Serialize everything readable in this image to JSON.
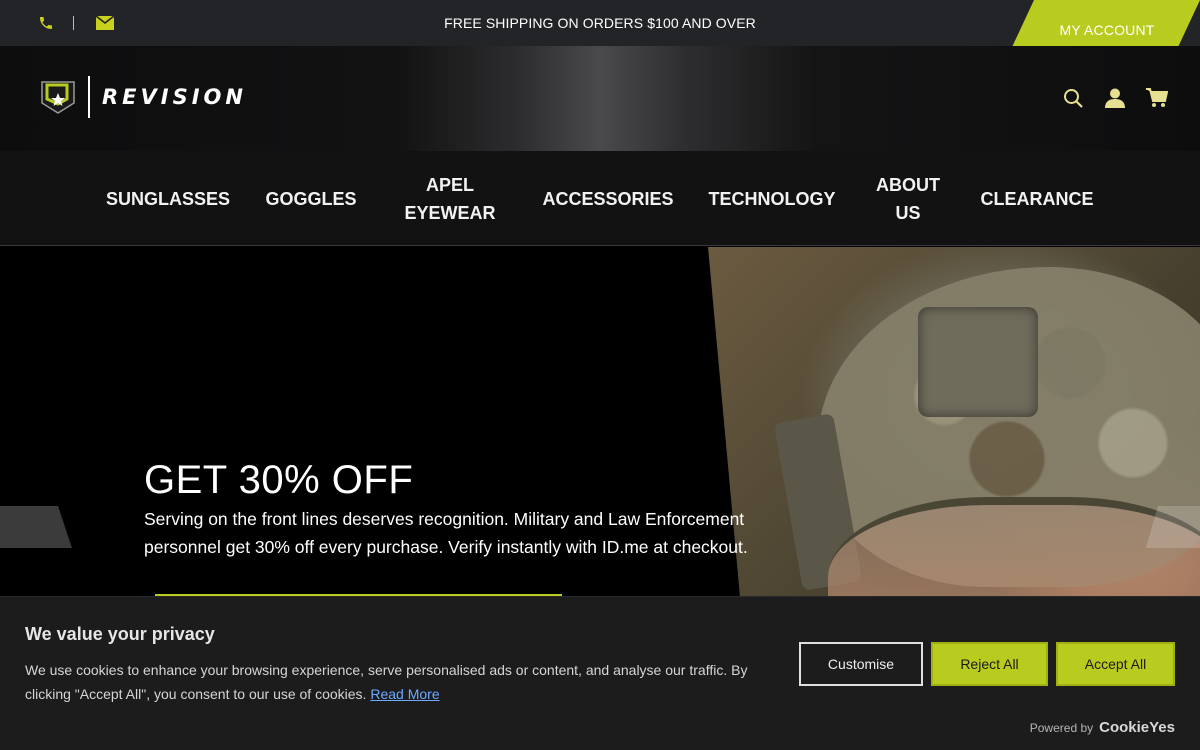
{
  "topbar": {
    "promo": "FREE SHIPPING ON ORDERS $100 AND OVER",
    "account_label": "MY ACCOUNT",
    "phone_icon": "phone-icon",
    "mail_icon": "mail-icon"
  },
  "header": {
    "logo_text": "REVISION",
    "icons": [
      "search-icon",
      "user-icon",
      "cart-icon"
    ]
  },
  "nav": {
    "items": [
      {
        "label": "SUNGLASSES"
      },
      {
        "label": "GOGGLES"
      },
      {
        "label": "APEL EYEWEAR"
      },
      {
        "label": "ACCESSORIES"
      },
      {
        "label": "TECHNOLOGY"
      },
      {
        "label": "ABOUT US"
      },
      {
        "label": "CLEARANCE"
      }
    ]
  },
  "hero": {
    "title": "GET 30% OFF",
    "description": "Serving on the front lines deserves recognition. Military and Law Enforcement personnel get 30% off every purchase. Verify instantly with ID.me at checkout."
  },
  "cookie": {
    "title": "We value your privacy",
    "text": "We use cookies to enhance your browsing experience, serve personalised ads or content, and analyse our traffic. By clicking \"Accept All\", you consent to our use of cookies.",
    "read_more": "Read More",
    "customise": "Customise",
    "reject": "Reject All",
    "accept": "Accept All",
    "powered_by": "Powered by",
    "powered_brand": "CookieYes"
  },
  "colors": {
    "accent": "#b8cc1f",
    "topbar_bg": "#232427",
    "cookie_bg": "#1c1c1d",
    "link": "#6ea8ff"
  }
}
